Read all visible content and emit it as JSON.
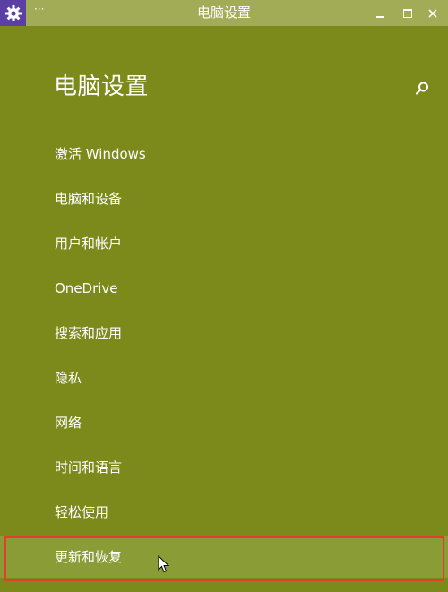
{
  "window": {
    "title": "电脑设置",
    "more_glyph": "···",
    "icons": {
      "app": "settings-gear-icon",
      "minimize": "minimize-icon",
      "maximize": "maximize-icon",
      "close": "close-icon"
    }
  },
  "header": {
    "title": "电脑设置",
    "search_icon": "search-icon"
  },
  "nav": {
    "items": [
      {
        "label": "激活 Windows"
      },
      {
        "label": "电脑和设备"
      },
      {
        "label": "用户和帐户"
      },
      {
        "label": "OneDrive"
      },
      {
        "label": "搜索和应用"
      },
      {
        "label": "隐私"
      },
      {
        "label": "网络"
      },
      {
        "label": "时间和语言"
      },
      {
        "label": "轻松使用"
      },
      {
        "label": "更新和恢复",
        "selected": true
      }
    ]
  },
  "colors": {
    "background": "#7b8a1a",
    "titlebar": "#a2ab55",
    "app_icon_bg": "#5c3fa4",
    "highlight_border": "#e0402c",
    "text": "#ffffff"
  }
}
